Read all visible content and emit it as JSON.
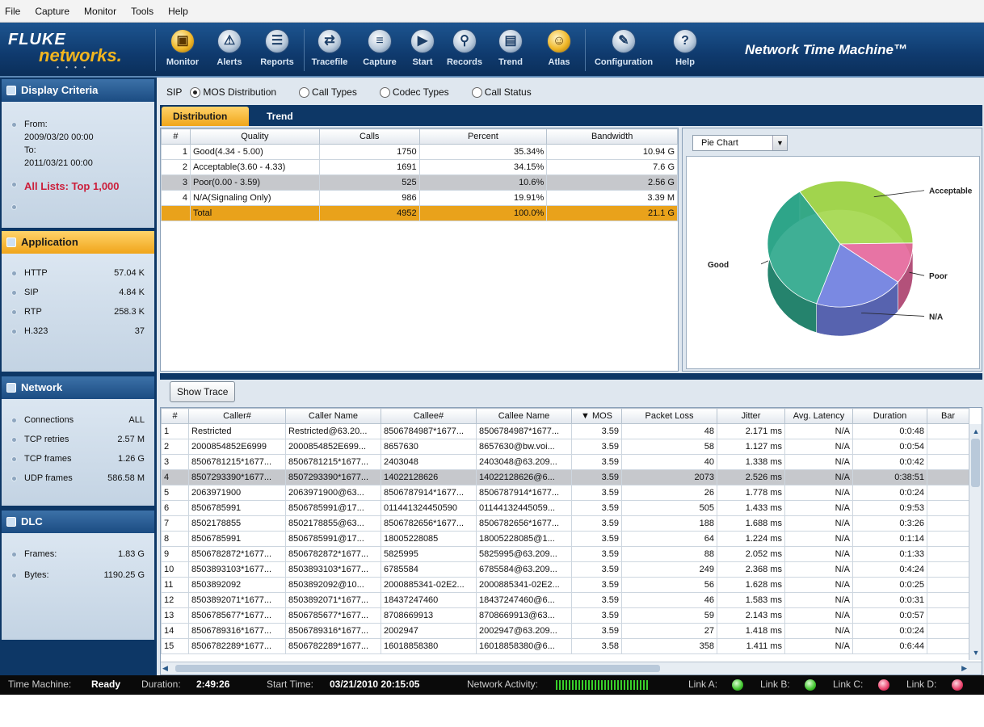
{
  "menu": [
    "File",
    "Capture",
    "Monitor",
    "Tools",
    "Help"
  ],
  "toolbar": {
    "brand_line1": "FLUKE",
    "brand_line2": "networks.",
    "buttons": [
      {
        "label": "Monitor",
        "icon": "monitor-icon"
      },
      {
        "label": "Alerts",
        "icon": "alert-icon"
      },
      {
        "label": "Reports",
        "icon": "reports-icon"
      },
      {
        "label": "Tracefile",
        "icon": "tracefile-icon"
      },
      {
        "label": "Capture",
        "icon": "capture-icon"
      },
      {
        "label": "Start",
        "icon": "play-icon"
      },
      {
        "label": "Records",
        "icon": "records-icon"
      },
      {
        "label": "Trend",
        "icon": "trend-icon"
      },
      {
        "label": "Atlas",
        "icon": "atlas-icon"
      },
      {
        "label": "Configuration",
        "icon": "wrench-icon"
      },
      {
        "label": "Help",
        "icon": "help-icon"
      }
    ],
    "product": "Network Time Machine™"
  },
  "sidebar": {
    "criteria": {
      "title": "Display Criteria",
      "from_label": "From:",
      "from_value": "2009/03/20 00:00",
      "to_label": "To:",
      "to_value": "2011/03/21 00:00",
      "lists": "All Lists: Top 1,000"
    },
    "application": {
      "title": "Application",
      "rows": [
        {
          "label": "HTTP",
          "value": "57.04 K"
        },
        {
          "label": "SIP",
          "value": "4.84 K"
        },
        {
          "label": "RTP",
          "value": "258.3 K"
        },
        {
          "label": "H.323",
          "value": "37"
        }
      ]
    },
    "network": {
      "title": "Network",
      "rows": [
        {
          "label": "Connections",
          "value": "ALL"
        },
        {
          "label": "TCP retries",
          "value": "2.57 M"
        },
        {
          "label": "TCP frames",
          "value": "1.26 G"
        },
        {
          "label": "UDP frames",
          "value": "586.58 M"
        }
      ]
    },
    "dlc": {
      "title": "DLC",
      "rows": [
        {
          "label": "Frames:",
          "value": "1.83 G"
        },
        {
          "label": "Bytes:",
          "value": "1190.25 G"
        }
      ]
    }
  },
  "filter": {
    "protocol": "SIP",
    "options": [
      "MOS Distribution",
      "Call Types",
      "Codec Types",
      "Call Status"
    ],
    "selected": "MOS Distribution"
  },
  "tabs": [
    "Distribution",
    "Trend"
  ],
  "distribution": {
    "columns": [
      "#",
      "Quality",
      "Calls",
      "Percent",
      "Bandwidth"
    ],
    "rows": [
      [
        "1",
        "Good(4.34 - 5.00)",
        "1750",
        "35.34%",
        "10.94 G"
      ],
      [
        "2",
        "Acceptable(3.60 - 4.33)",
        "1691",
        "34.15%",
        "7.6 G"
      ],
      [
        "3",
        "Poor(0.00 - 3.59)",
        "525",
        "10.6%",
        "2.56 G"
      ],
      [
        "4",
        "N/A(Signaling Only)",
        "986",
        "19.91%",
        "3.39 M"
      ]
    ],
    "total": [
      "",
      "Total",
      "4952",
      "100.0%",
      "21.1 G"
    ]
  },
  "chart_selector": "Pie Chart",
  "chart_data": {
    "type": "pie",
    "labels": [
      "Acceptable",
      "Poor",
      "N/A",
      "Good"
    ],
    "values": [
      34.15,
      10.6,
      19.91,
      35.34
    ],
    "colors": [
      "#a4d84e",
      "#e5689c",
      "#6f7fe0",
      "#2fa88c"
    ]
  },
  "show_trace": "Show Trace",
  "calls": {
    "columns": [
      "#",
      "Caller#",
      "Caller Name",
      "Callee#",
      "Callee Name",
      "▼ MOS",
      "Packet Loss",
      "Jitter",
      "Avg. Latency",
      "Duration",
      "Bar"
    ],
    "rows": [
      [
        "1",
        "Restricted",
        "Restricted@63.20...",
        "8506784987*1677...",
        "8506784987*1677...",
        "3.59",
        "48",
        "2.171 ms",
        "N/A",
        "0:0:48"
      ],
      [
        "2",
        "2000854852E6999",
        "2000854852E699...",
        "8657630",
        "8657630@bw.voi...",
        "3.59",
        "58",
        "1.127 ms",
        "N/A",
        "0:0:54"
      ],
      [
        "3",
        "8506781215*1677...",
        "8506781215*1677...",
        "2403048",
        "2403048@63.209...",
        "3.59",
        "40",
        "1.338 ms",
        "N/A",
        "0:0:42"
      ],
      [
        "4",
        "8507293390*1677...",
        "8507293390*1677...",
        "14022128626",
        "14022128626@6...",
        "3.59",
        "2073",
        "2.526 ms",
        "N/A",
        "0:38:51"
      ],
      [
        "5",
        "2063971900",
        "2063971900@63...",
        "8506787914*1677...",
        "8506787914*1677...",
        "3.59",
        "26",
        "1.778 ms",
        "N/A",
        "0:0:24"
      ],
      [
        "6",
        "8506785991",
        "8506785991@17...",
        "011441324450590",
        "01144132445059...",
        "3.59",
        "505",
        "1.433 ms",
        "N/A",
        "0:9:53"
      ],
      [
        "7",
        "8502178855",
        "8502178855@63...",
        "8506782656*1677...",
        "8506782656*1677...",
        "3.59",
        "188",
        "1.688 ms",
        "N/A",
        "0:3:26"
      ],
      [
        "8",
        "8506785991",
        "8506785991@17...",
        "18005228085",
        "18005228085@1...",
        "3.59",
        "64",
        "1.224 ms",
        "N/A",
        "0:1:14"
      ],
      [
        "9",
        "8506782872*1677...",
        "8506782872*1677...",
        "5825995",
        "5825995@63.209...",
        "3.59",
        "88",
        "2.052 ms",
        "N/A",
        "0:1:33"
      ],
      [
        "10",
        "8503893103*1677...",
        "8503893103*1677...",
        "6785584",
        "6785584@63.209...",
        "3.59",
        "249",
        "2.368 ms",
        "N/A",
        "0:4:24"
      ],
      [
        "11",
        "8503892092",
        "8503892092@10...",
        "2000885341-02E2...",
        "2000885341-02E2...",
        "3.59",
        "56",
        "1.628 ms",
        "N/A",
        "0:0:25"
      ],
      [
        "12",
        "8503892071*1677...",
        "8503892071*1677...",
        "18437247460",
        "18437247460@6...",
        "3.59",
        "46",
        "1.583 ms",
        "N/A",
        "0:0:31"
      ],
      [
        "13",
        "8506785677*1677...",
        "8506785677*1677...",
        "8708669913",
        "8708669913@63...",
        "3.59",
        "59",
        "2.143 ms",
        "N/A",
        "0:0:57"
      ],
      [
        "14",
        "8506789316*1677...",
        "8506789316*1677...",
        "2002947",
        "2002947@63.209...",
        "3.59",
        "27",
        "1.418 ms",
        "N/A",
        "0:0:24"
      ],
      [
        "15",
        "8506782289*1677...",
        "8506782289*1677...",
        "16018858380",
        "16018858380@6...",
        "3.58",
        "358",
        "1.411 ms",
        "N/A",
        "0:6:44"
      ]
    ]
  },
  "status": {
    "tm_label": "Time Machine:",
    "tm_value": "Ready",
    "duration_label": "Duration:",
    "duration_value": "2:49:26",
    "start_label": "Start Time:",
    "start_value": "03/21/2010 20:15:05",
    "activity_label": "Network Activity:",
    "links": [
      {
        "label": "Link A:",
        "state": "green"
      },
      {
        "label": "Link B:",
        "state": "green"
      },
      {
        "label": "Link C:",
        "state": "red"
      },
      {
        "label": "Link D:",
        "state": "red"
      }
    ]
  }
}
